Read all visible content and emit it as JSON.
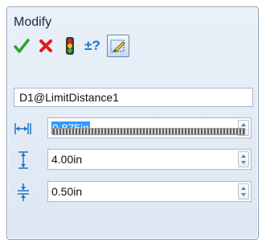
{
  "dialog": {
    "title": "Modify"
  },
  "toolbar": {
    "buttons": [
      {
        "name": "ok-check-icon",
        "color": "#2ea32e"
      },
      {
        "name": "cancel-x-icon",
        "color": "#e01b1b"
      },
      {
        "name": "rebuild-traffic-light-icon",
        "colors": [
          "#e02424",
          "#f0c020",
          "#2fb12f"
        ]
      },
      {
        "name": "reverse-sense-icon",
        "label": "±?"
      },
      {
        "name": "mark-for-drawing-icon",
        "active": true
      }
    ]
  },
  "dimension_name": "D1@LimitDistance1",
  "fields": [
    {
      "icon": "distance-value-icon",
      "value": "0.875in",
      "selected": true
    },
    {
      "icon": "max-distance-icon",
      "value": "4.00in"
    },
    {
      "icon": "min-distance-icon",
      "value": "0.50in"
    }
  ],
  "colors": {
    "accent_selection": "#3399ff",
    "icon_blue": "#1e73c8"
  }
}
